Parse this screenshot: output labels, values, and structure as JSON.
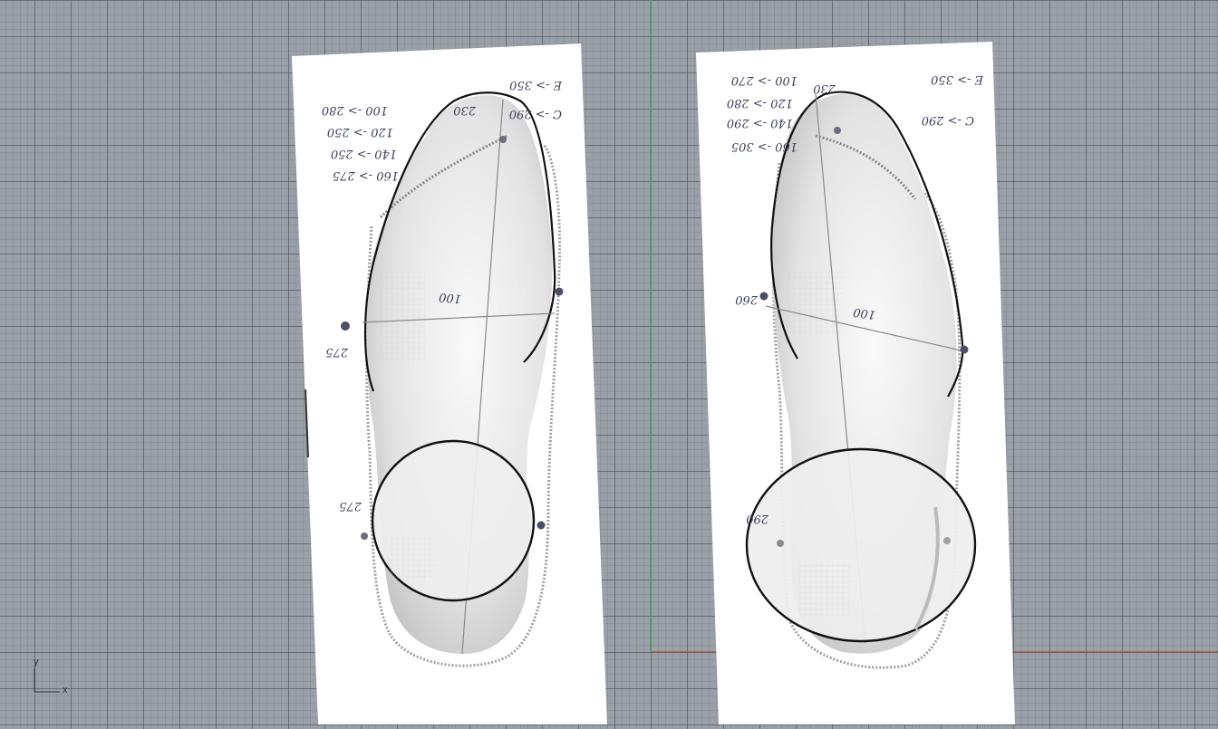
{
  "viewport": {
    "axis_labels": {
      "x": "x",
      "y": "y"
    },
    "colors": {
      "background": "#9aa0a8",
      "grid": "#5f6570",
      "world_y_axis": "#3fa34d",
      "world_x_axis": "#a04a3c",
      "paper": "#ffffff",
      "curve": "#111111"
    }
  },
  "left_sheet": {
    "notes_left": [
      "160 -> 275",
      "140 -> 250",
      "120 -> 250",
      "100 -> 280"
    ],
    "notes_right": [
      "C -> 290",
      "E -> 350"
    ],
    "side_top": "275",
    "side_bottom": "275",
    "center": "100",
    "toe": "230"
  },
  "right_sheet": {
    "notes_left": [
      "160 -> 305",
      "140 -> 290",
      "120 -> 280",
      "100 -> 270"
    ],
    "notes_right": [
      "C -> 290",
      "E -> 350"
    ],
    "side_mid": "260",
    "center": "100",
    "side_bottom": "290",
    "toe": "230"
  }
}
